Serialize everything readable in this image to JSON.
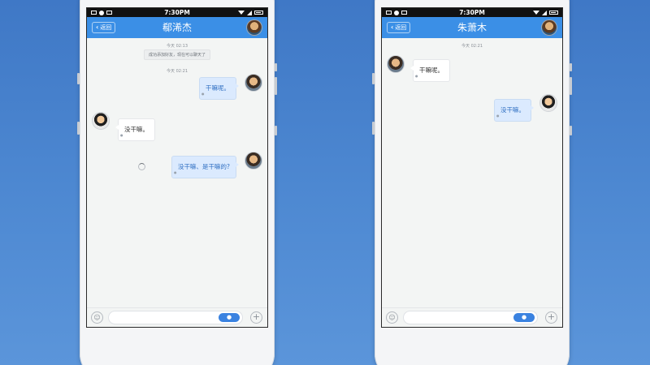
{
  "colors": {
    "accent": "#3b8fe6",
    "background": "#4a85cf",
    "outgoing_bubble": "#dbeafe",
    "outgoing_text": "#2f6fc2"
  },
  "left_phone": {
    "status_bar": {
      "time": "7:30PM"
    },
    "nav": {
      "back_label": "返回",
      "title": "郗浠杰"
    },
    "messages": {
      "ts1": "今天 02:13",
      "system_note": "成功添加好友，现在可以聊天了",
      "ts2": "今天 02:21",
      "m1": "干嘛呢。",
      "m2": "没干嘛。",
      "m3": "没干嘛、是干嘛的?"
    },
    "input": {
      "emoji_icon": "smile-icon",
      "mic_icon": "microphone-icon",
      "plus_label": "+"
    }
  },
  "right_phone": {
    "status_bar": {
      "time": "7:30PM"
    },
    "nav": {
      "back_label": "返回",
      "title": "朱萧木"
    },
    "messages": {
      "ts1": "今天 02:21",
      "m1": "干嘛呢。",
      "m2": "没干嘛。"
    },
    "input": {
      "emoji_icon": "smile-icon",
      "mic_icon": "microphone-icon",
      "plus_label": "+"
    }
  }
}
